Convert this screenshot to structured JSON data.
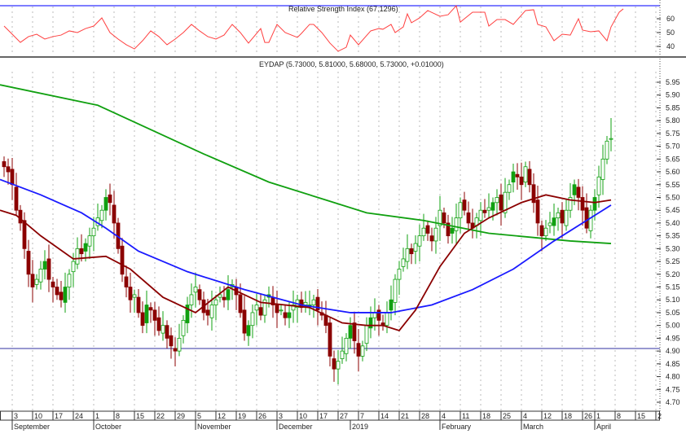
{
  "chart_data": [
    {
      "type": "line",
      "title": "Relative Strength Index (67.1296)",
      "y_ticks": [
        60,
        50,
        40
      ],
      "ylim": [
        35,
        69.4
      ],
      "upper_line": 69.4,
      "series": [
        {
          "name": "RSI",
          "color": "#ff4040",
          "points": [
            [
              0,
              54.7
            ],
            [
              2,
              48.8
            ],
            [
              4,
              42.9
            ],
            [
              6,
              47.1
            ],
            [
              8,
              48.8
            ],
            [
              10,
              45.3
            ],
            [
              12,
              47.1
            ],
            [
              14,
              48.2
            ],
            [
              16,
              51.2
            ],
            [
              18,
              50
            ],
            [
              20,
              52.9
            ],
            [
              22,
              54.7
            ],
            [
              24,
              60.6
            ],
            [
              26,
              50
            ],
            [
              28,
              45.3
            ],
            [
              30,
              41.2
            ],
            [
              32,
              38.2
            ],
            [
              34,
              44.1
            ],
            [
              36,
              51.2
            ],
            [
              38,
              47.1
            ],
            [
              40,
              41.2
            ],
            [
              42,
              45.3
            ],
            [
              44,
              50
            ],
            [
              46,
              55.9
            ],
            [
              48,
              51.2
            ],
            [
              50,
              47.1
            ],
            [
              52,
              45.3
            ],
            [
              54,
              48.2
            ],
            [
              56,
              55.9
            ],
            [
              58,
              50
            ],
            [
              60,
              42.4
            ],
            [
              63,
              52.9
            ],
            [
              64,
              42.9
            ],
            [
              65,
              42.9
            ],
            [
              67,
              55.9
            ],
            [
              69,
              50
            ],
            [
              72,
              46.5
            ],
            [
              73,
              49.4
            ],
            [
              75,
              55.9
            ],
            [
              76,
              55.9
            ],
            [
              78,
              50
            ],
            [
              80,
              42.4
            ],
            [
              82,
              36.5
            ],
            [
              84,
              39.4
            ],
            [
              85,
              48.2
            ],
            [
              87,
              41.2
            ],
            [
              90,
              51.2
            ],
            [
              92,
              52.9
            ],
            [
              93,
              52.4
            ],
            [
              95,
              55.9
            ],
            [
              96,
              50
            ],
            [
              98,
              54.1
            ],
            [
              99,
              63.5
            ],
            [
              100,
              57.1
            ],
            [
              102,
              60.6
            ],
            [
              104,
              65.9
            ],
            [
              107,
              61.8
            ],
            [
              109,
              62.9
            ],
            [
              111,
              69.4
            ],
            [
              112,
              57.6
            ],
            [
              115,
              64.7
            ],
            [
              118,
              64.7
            ],
            [
              119,
              54.7
            ],
            [
              121,
              59.4
            ],
            [
              123,
              59.4
            ],
            [
              125,
              55.9
            ],
            [
              128,
              65.9
            ],
            [
              130,
              66.5
            ],
            [
              131,
              55.9
            ],
            [
              133,
              54.1
            ],
            [
              135,
              44.1
            ],
            [
              137,
              48.8
            ],
            [
              139,
              48.2
            ],
            [
              141,
              60
            ],
            [
              142,
              51.8
            ],
            [
              144,
              50.6
            ],
            [
              146,
              51.2
            ],
            [
              148,
              44.1
            ],
            [
              149,
              54.1
            ],
            [
              151,
              64.7
            ],
            [
              152,
              67.1
            ]
          ]
        }
      ]
    },
    {
      "type": "candlestick",
      "title": "EYDAP (5.73000, 5.81000, 5.68000, 5.73000, +0.01000)",
      "last_ohlc": {
        "open": 5.73,
        "high": 5.81,
        "low": 5.68,
        "close": 5.73,
        "change": 0.01
      },
      "ylim": [
        4.7,
        5.95
      ],
      "y_ticks": [
        "5.95",
        "5.90",
        "5.85",
        "5.80",
        "5.75",
        "5.70",
        "5.65",
        "5.60",
        "5.55",
        "5.50",
        "5.45",
        "5.40",
        "5.35",
        "5.30",
        "5.25",
        "5.20",
        "5.15",
        "5.10",
        "5.05",
        "5.00",
        "4.95",
        "4.90",
        "4.85",
        "4.80",
        "4.75",
        "4.70"
      ],
      "support_line": 4.91,
      "closes": [
        5.62,
        5.6,
        5.55,
        5.45,
        5.4,
        5.3,
        5.2,
        5.15,
        5.18,
        5.22,
        5.25,
        5.18,
        5.15,
        5.12,
        5.1,
        5.15,
        5.2,
        5.25,
        5.3,
        5.28,
        5.32,
        5.35,
        5.38,
        5.42,
        5.45,
        5.5,
        5.48,
        5.4,
        5.3,
        5.2,
        5.15,
        5.1,
        5.12,
        5.05,
        5.0,
        5.08,
        5.06,
        5.02,
        4.98,
        5.0,
        4.95,
        4.92,
        4.9,
        4.95,
        5.02,
        5.08,
        5.12,
        5.15,
        5.1,
        5.05,
        5.04,
        5.08,
        5.1,
        5.12,
        5.1,
        5.14,
        5.16,
        5.12,
        5.05,
        4.97,
        5.0,
        5.05,
        5.08,
        5.04,
        5.1,
        5.12,
        5.08,
        5.05,
        5.06,
        5.03,
        5.05,
        5.08,
        5.1,
        5.07,
        5.09,
        5.08,
        5.1,
        5.06,
        5.04,
        5.0,
        4.88,
        4.83,
        4.86,
        4.9,
        4.95,
        5.0,
        4.94,
        4.88,
        4.92,
        5.0,
        5.03,
        5.05,
        5.02,
        5.0,
        5.05,
        5.1,
        5.18,
        5.22,
        5.26,
        5.3,
        5.28,
        5.32,
        5.35,
        5.38,
        5.36,
        5.33,
        5.38,
        5.45,
        5.4,
        5.35,
        5.38,
        5.42,
        5.48,
        5.45,
        5.4,
        5.38,
        5.42,
        5.45,
        5.44,
        5.46,
        5.48,
        5.5,
        5.45,
        5.52,
        5.55,
        5.6,
        5.58,
        5.55,
        5.62,
        5.55,
        5.48,
        5.4,
        5.35,
        5.38,
        5.4,
        5.42,
        5.44,
        5.4,
        5.45,
        5.5,
        5.55,
        5.5,
        5.45,
        5.38,
        5.45,
        5.5,
        5.58,
        5.65,
        5.72,
        5.73
      ],
      "moving_averages": [
        {
          "name": "long MA",
          "color": "#10a010",
          "points": [
            [
              -1,
              5.94
            ],
            [
              23,
              5.86
            ],
            [
              49,
              5.67
            ],
            [
              65,
              5.56
            ],
            [
              79,
              5.49
            ],
            [
              89,
              5.44
            ],
            [
              103,
              5.41
            ],
            [
              119,
              5.36
            ],
            [
              139,
              5.33
            ],
            [
              149,
              5.32
            ]
          ]
        },
        {
          "name": "medium MA",
          "color": "#1a1aff",
          "points": [
            [
              -1,
              5.57
            ],
            [
              9,
              5.51
            ],
            [
              19,
              5.44
            ],
            [
              25,
              5.38
            ],
            [
              33,
              5.29
            ],
            [
              45,
              5.21
            ],
            [
              59,
              5.14
            ],
            [
              73,
              5.08
            ],
            [
              85,
              5.05
            ],
            [
              95,
              5.05
            ],
            [
              105,
              5.08
            ],
            [
              115,
              5.14
            ],
            [
              125,
              5.22
            ],
            [
              135,
              5.33
            ],
            [
              143,
              5.41
            ],
            [
              149,
              5.47
            ]
          ]
        },
        {
          "name": "short MA",
          "color": "#8b0000",
          "points": [
            [
              -1,
              5.45
            ],
            [
              3,
              5.43
            ],
            [
              9,
              5.35
            ],
            [
              17,
              5.26
            ],
            [
              25,
              5.27
            ],
            [
              31,
              5.22
            ],
            [
              39,
              5.11
            ],
            [
              47,
              5.05
            ],
            [
              55,
              5.15
            ],
            [
              63,
              5.09
            ],
            [
              75,
              5.07
            ],
            [
              83,
              5.01
            ],
            [
              89,
              5.0
            ],
            [
              93,
              5.0
            ],
            [
              97,
              4.98
            ],
            [
              101,
              5.06
            ],
            [
              107,
              5.23
            ],
            [
              113,
              5.36
            ],
            [
              119,
              5.42
            ],
            [
              127,
              5.48
            ],
            [
              133,
              5.51
            ],
            [
              139,
              5.49
            ],
            [
              145,
              5.48
            ],
            [
              149,
              5.49
            ]
          ]
        }
      ],
      "x_day_ticks": [
        {
          "label": "3",
          "day": 2
        },
        {
          "label": "10",
          "day": 7
        },
        {
          "label": "17",
          "day": 12
        },
        {
          "label": "24",
          "day": 17
        },
        {
          "label": "1",
          "day": 22
        },
        {
          "label": "8",
          "day": 27
        },
        {
          "label": "15",
          "day": 32
        },
        {
          "label": "22",
          "day": 37
        },
        {
          "label": "29",
          "day": 42
        },
        {
          "label": "5",
          "day": 47
        },
        {
          "label": "12",
          "day": 52
        },
        {
          "label": "19",
          "day": 57
        },
        {
          "label": "26",
          "day": 62
        },
        {
          "label": "3",
          "day": 67
        },
        {
          "label": "10",
          "day": 72
        },
        {
          "label": "17",
          "day": 77
        },
        {
          "label": "27",
          "day": 82
        },
        {
          "label": "7",
          "day": 87
        },
        {
          "label": "14",
          "day": 92
        },
        {
          "label": "21",
          "day": 97
        },
        {
          "label": "28",
          "day": 102
        },
        {
          "label": "4",
          "day": 107
        },
        {
          "label": "11",
          "day": 112
        },
        {
          "label": "18",
          "day": 117
        },
        {
          "label": "25",
          "day": 122
        },
        {
          "label": "4",
          "day": 127
        },
        {
          "label": "12",
          "day": 132
        },
        {
          "label": "18",
          "day": 137
        },
        {
          "label": "26",
          "day": 142
        },
        {
          "label": "1",
          "day": 145
        },
        {
          "label": "8",
          "day": 150
        },
        {
          "label": "15",
          "day": 155
        },
        {
          "label": "2",
          "day": 160
        }
      ],
      "x_month_ticks": [
        {
          "label": "September",
          "day": 2
        },
        {
          "label": "October",
          "day": 22
        },
        {
          "label": "November",
          "day": 47
        },
        {
          "label": "December",
          "day": 67
        },
        {
          "label": "2019",
          "day": 85
        },
        {
          "label": "February",
          "day": 107
        },
        {
          "label": "March",
          "day": 127
        },
        {
          "label": "April",
          "day": 145
        }
      ]
    }
  ]
}
